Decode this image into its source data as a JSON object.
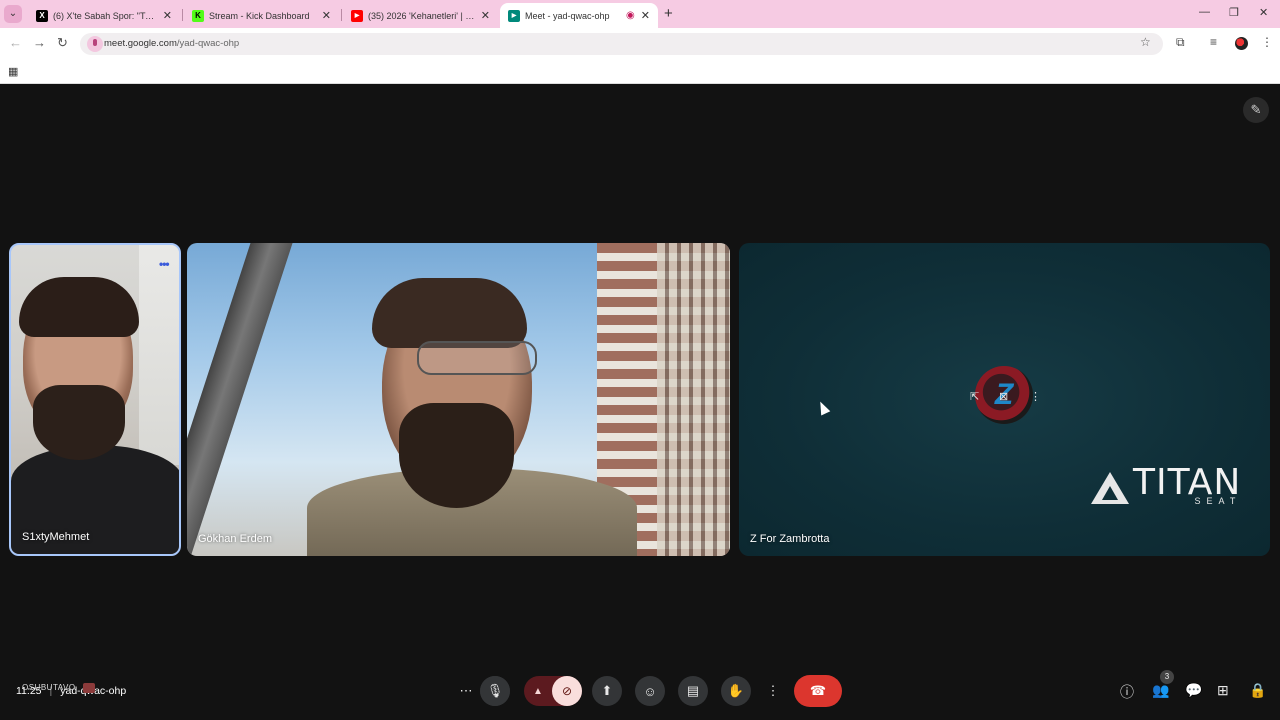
{
  "browser": {
    "tabs": [
      {
        "title": "(6) X'te Sabah Spor: \"Trabzonsp",
        "favicon": "x-icon",
        "favicon_color": "#000000",
        "favicon_glyph": "𝕏"
      },
      {
        "title": "Stream - Kick Dashboard",
        "favicon": "kick-icon",
        "favicon_color": "#53fc18",
        "favicon_glyph": "K"
      },
      {
        "title": "(35) 2026 'Kehanetleri' | Erdem A",
        "favicon": "youtube-icon",
        "favicon_color": "#ff0000",
        "favicon_glyph": "▶"
      },
      {
        "title": "Meet - yad-qwac-ohp",
        "favicon": "meet-icon",
        "favicon_color": "#00897b",
        "favicon_glyph": "▶",
        "active": true
      }
    ],
    "address": {
      "domain": "meet.google.com",
      "path": "/yad-qwac-ohp"
    }
  },
  "meet": {
    "tiles": [
      {
        "name": "S1xtyMehmet",
        "highlighted": true
      },
      {
        "name": "Gökhan Erdem"
      },
      {
        "name": "Z For Zambrotta",
        "avatar_letter": "Z",
        "sponsor_word": "TITAN",
        "sponsor_sub": "SEAT"
      }
    ],
    "meeting_time": "11:25",
    "meeting_code": "yad-qwac-ohp",
    "overlay_text": "OSUBUTAVO",
    "participants_count": "3",
    "colors": {
      "leave": "#dc362e",
      "camera_off_bg": "#f9dedc",
      "active_border": "#a8c7fa"
    }
  }
}
